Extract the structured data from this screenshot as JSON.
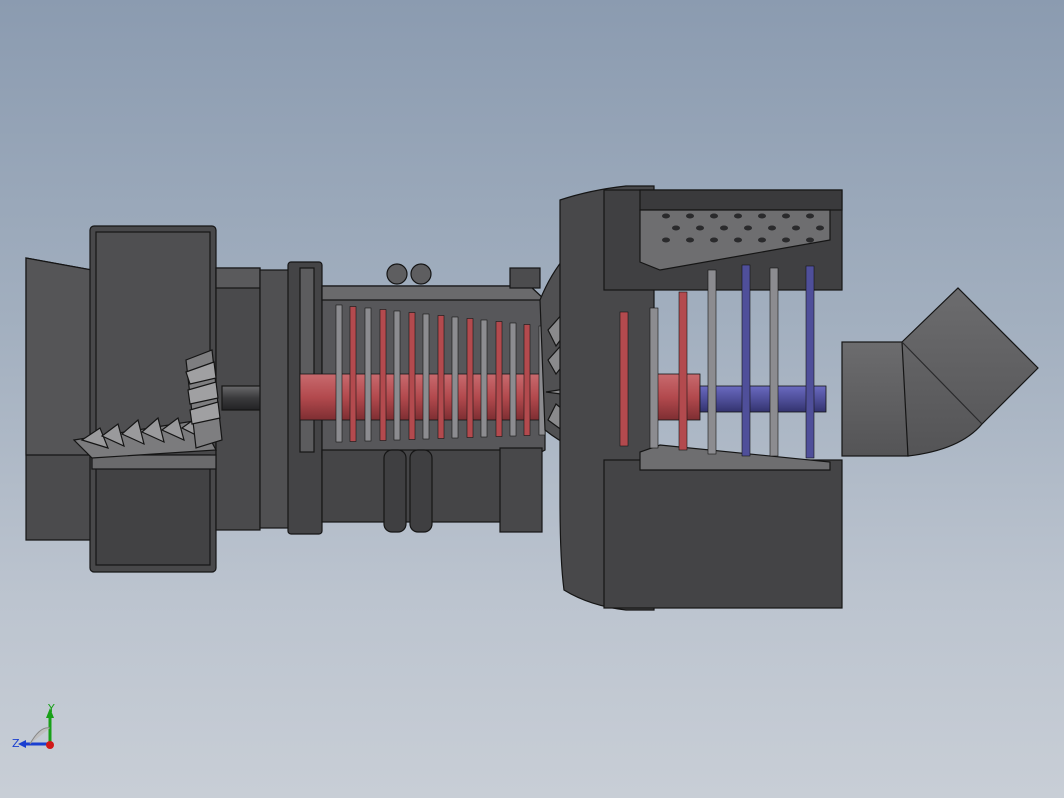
{
  "viewport": {
    "background_top": "#8b9bb0",
    "background_bottom": "#c8ced6"
  },
  "model": {
    "housing_color": "#4a4a4c",
    "housing_dark": "#303032",
    "compressor_color": "#b34a4e",
    "turbine_color": "#4f4f9a",
    "shaft_color": "#b34a4e"
  },
  "triad": {
    "x_color": "#d01818",
    "y_color": "#18a018",
    "z_color": "#1a3fd0",
    "y_label": "Y",
    "z_label": "Z"
  }
}
